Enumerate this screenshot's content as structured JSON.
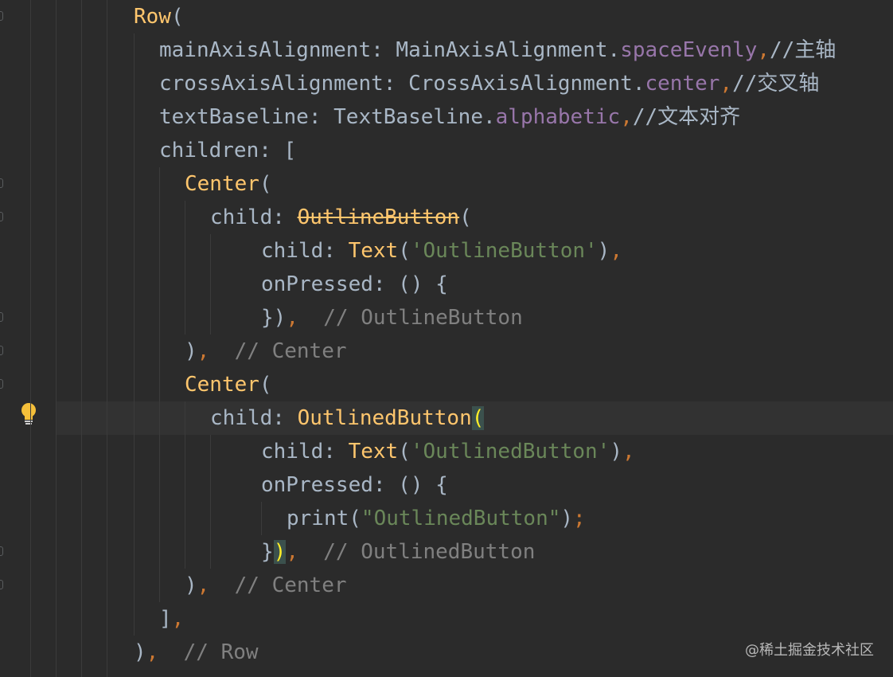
{
  "editor": {
    "lines": [
      {
        "t1": "Row",
        "t2": "("
      },
      {
        "t1": "mainAxisAlignment: MainAxisAlignment.",
        "t2": "spaceEvenly",
        "t3": ",",
        "t4": "//主轴"
      },
      {
        "t1": "crossAxisAlignment: CrossAxisAlignment.",
        "t2": "center",
        "t3": ",",
        "t4": "//交叉轴"
      },
      {
        "t1": "textBaseline: TextBaseline.",
        "t2": "alphabetic",
        "t3": ",",
        "t4": "//文本对齐"
      },
      {
        "t1": "children: ["
      },
      {
        "t1": "Center",
        "t2": "("
      },
      {
        "t1": "child: ",
        "t2": "OutlineButton",
        "t3": "("
      },
      {
        "t1": "child: ",
        "t2": "Text",
        "t3": "(",
        "t4": "'OutlineButton'",
        "t5": ")",
        "t6": ","
      },
      {
        "t1": "onPressed: () {"
      },
      {
        "t1": "})",
        "t2": ",",
        "t3": "  // OutlineButton"
      },
      {
        "t1": ")",
        "t2": ",",
        "t3": "  // Center"
      },
      {
        "t1": "Center",
        "t2": "("
      },
      {
        "t1": "child: ",
        "t2": "OutlinedButton",
        "t3": "("
      },
      {
        "t1": "child: ",
        "t2": "Text",
        "t3": "(",
        "t4": "'OutlinedButton'",
        "t5": ")",
        "t6": ","
      },
      {
        "t1": "onPressed: () {"
      },
      {
        "t1": "print(",
        "t2": "\"OutlinedButton\"",
        "t3": ")",
        "t4": ";"
      },
      {
        "t1": "}",
        "t2": ")",
        "t3": ",",
        "t4": "  // OutlinedButton"
      },
      {
        "t1": ")",
        "t2": ",",
        "t3": "  // Center"
      },
      {
        "t1": "]",
        "t2": ","
      },
      {
        "t1": ")",
        "t2": ",",
        "t3": "  // Row"
      }
    ]
  },
  "watermark": "@稀土掘金技术社区",
  "colors": {
    "background": "#2b2b2b",
    "class_name": "#ffc66d",
    "identifier": "#a9b7c6",
    "field": "#9876aa",
    "keyword_punct": "#cc7832",
    "string": "#6a8759",
    "comment": "#808080"
  },
  "icons": [
    "intention-bulb-icon",
    "fold-marker-icon"
  ]
}
